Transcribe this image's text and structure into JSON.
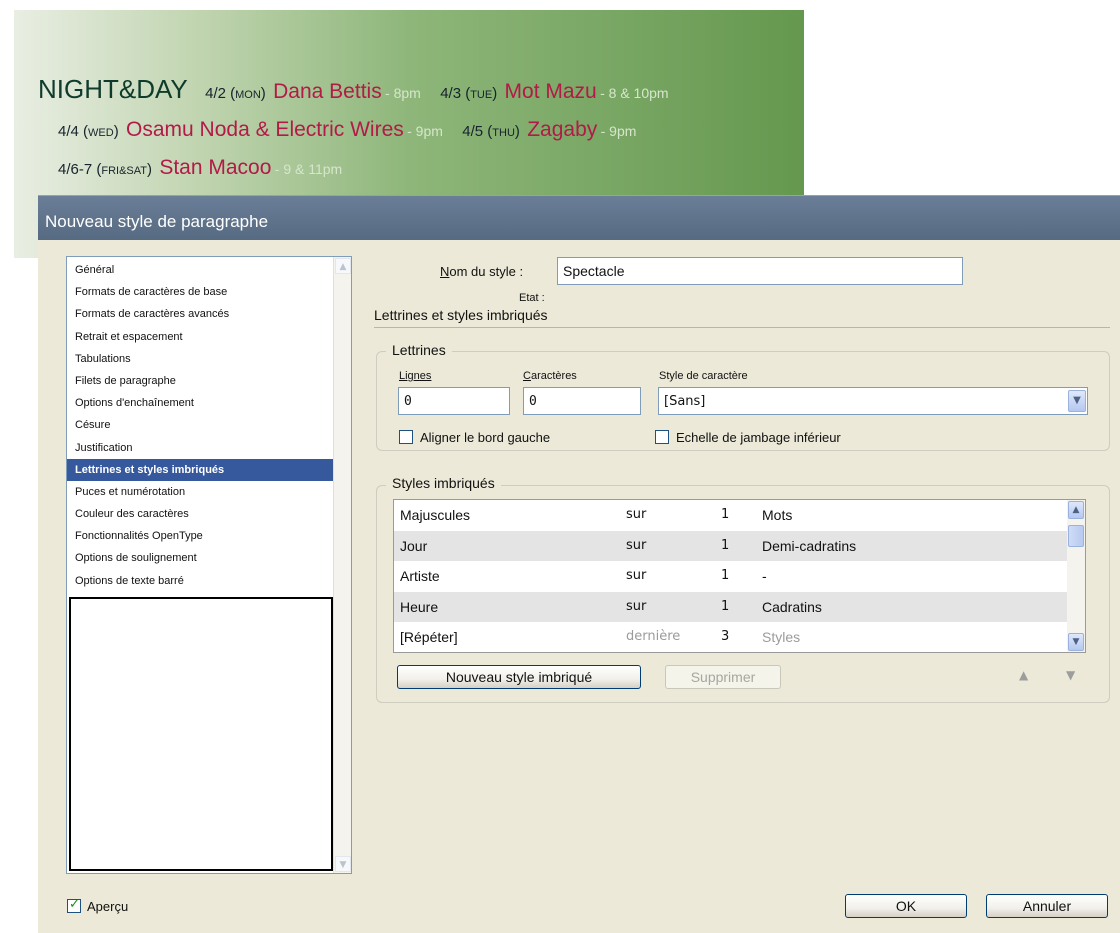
{
  "banner": {
    "title": "NIGHT&DAY",
    "events": [
      {
        "date": "4/2 (",
        "day": "MON",
        "date_end": ")",
        "artist": "Dana Bettis",
        "time": " - 8pm"
      },
      {
        "date": "4/3 (",
        "day": "TUE",
        "date_end": ")",
        "artist": "Mot Mazu",
        "time": " - 8 & 10pm"
      },
      {
        "date": "4/4 (",
        "day": "WED",
        "date_end": ")",
        "artist": "Osamu Noda & Electric Wires",
        "time": " - 9pm"
      },
      {
        "date": "4/5 (",
        "day": "THU",
        "date_end": ")",
        "artist": "Zagaby",
        "time": " - 9pm"
      },
      {
        "date": "4/6-7 (",
        "day": "FRI&SAT",
        "date_end": ")",
        "artist": "Stan Macoo",
        "time": " - 9 & 11pm"
      }
    ]
  },
  "dialog": {
    "title": "Nouveau style de paragraphe",
    "categories": [
      "Général",
      "Formats de caractères de base",
      "Formats de caractères avancés",
      "Retrait et espacement",
      "Tabulations",
      "Filets de paragraphe",
      "Options d'enchaînement",
      "Césure",
      "Justification",
      "Lettrines et styles imbriqués",
      "Puces et numérotation",
      "Couleur des caractères",
      "Fonctionnalités OpenType",
      "Options de soulignement",
      "Options de texte barré"
    ],
    "selected_category": "Lettrines et styles imbriqués",
    "style_name_label": "Nom du style :",
    "style_name_value": "Spectacle",
    "state_label": "Etat :",
    "section_title": "Lettrines et styles imbriqués",
    "dropcaps": {
      "legend": "Lettrines",
      "lines_label": "Lignes",
      "lines_value": "0",
      "chars_label": "Caractères",
      "chars_value": "0",
      "charstyle_label": "Style de caractère",
      "charstyle_value": "[Sans]",
      "align_left_label": "Aligner le bord gauche",
      "align_left_checked": false,
      "descender_label": "Echelle de jambage inférieur",
      "descender_checked": false
    },
    "nested": {
      "legend": "Styles imbriqués",
      "rows": [
        {
          "style": "Majuscules",
          "through": "sur",
          "count": "1",
          "unit": "Mots"
        },
        {
          "style": "Jour",
          "through": "sur",
          "count": "1",
          "unit": "Demi-cadratins"
        },
        {
          "style": "Artiste",
          "through": "sur",
          "count": "1",
          "unit": "-"
        },
        {
          "style": "Heure",
          "through": "sur",
          "count": "1",
          "unit": "Cadratins"
        },
        {
          "style": "[Répéter]",
          "through": "dernière",
          "count": "3",
          "unit": "Styles"
        }
      ],
      "new_button": "Nouveau style imbriqué",
      "delete_button": "Supprimer"
    },
    "preview_label": "Aperçu",
    "preview_checked": true,
    "ok_button": "OK",
    "cancel_button": "Annuler"
  }
}
